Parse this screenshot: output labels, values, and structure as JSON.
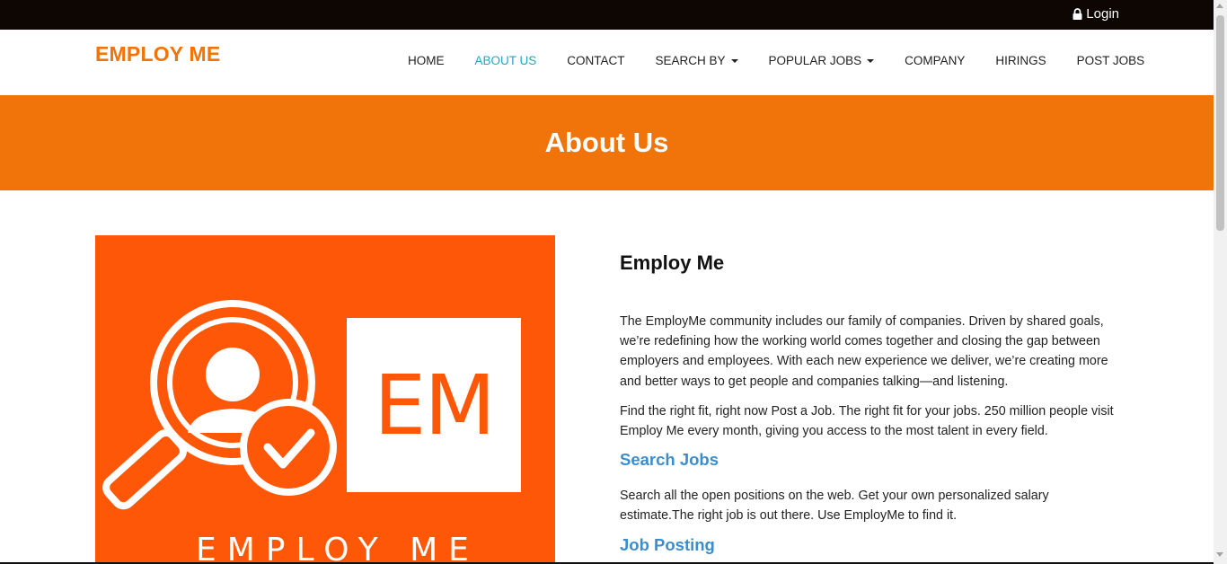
{
  "topbar": {
    "login_label": "Login",
    "login_icon": "lock-icon"
  },
  "navbar": {
    "brand": "EMPLOY ME",
    "items": [
      {
        "label": "HOME",
        "active": false,
        "dropdown": false
      },
      {
        "label": "ABOUT US",
        "active": true,
        "dropdown": false
      },
      {
        "label": "CONTACT",
        "active": false,
        "dropdown": false
      },
      {
        "label": "SEARCH BY",
        "active": false,
        "dropdown": true
      },
      {
        "label": "POPULAR JOBS",
        "active": false,
        "dropdown": true
      },
      {
        "label": "COMPANY",
        "active": false,
        "dropdown": false
      },
      {
        "label": "HIRINGS",
        "active": false,
        "dropdown": false
      },
      {
        "label": "POST JOBS",
        "active": false,
        "dropdown": false
      }
    ],
    "active_color": "#1fa8bf"
  },
  "banner": {
    "title": "About Us",
    "color": "#f07409"
  },
  "hero_image": {
    "monogram": "EM",
    "caption": "EMPLOY ME",
    "background_color": "#fe5707",
    "icons": [
      "search-user-icon",
      "check-circle-icon"
    ]
  },
  "content": {
    "heading": "Employ Me",
    "paragraph1": "The EmployMe community includes our family of companies. Driven by shared goals, we’re redefining how the working world comes together and closing the gap between employers and employees. With each new experience we deliver, we’re creating more and better ways to get people and companies talking—and listening.",
    "paragraph2": "Find the right fit, right now Post a Job. The right fit for your jobs. 250 million people visit Employ Me every month, giving you access to the most talent in every field.",
    "section1_title": "Search Jobs",
    "section1_text": "Search all the open positions on the web. Get your own personalized salary estimate.The right job is out there. Use EmployMe to find it.",
    "section2_title": "Job Posting",
    "link_color": "#3c8dcd"
  }
}
